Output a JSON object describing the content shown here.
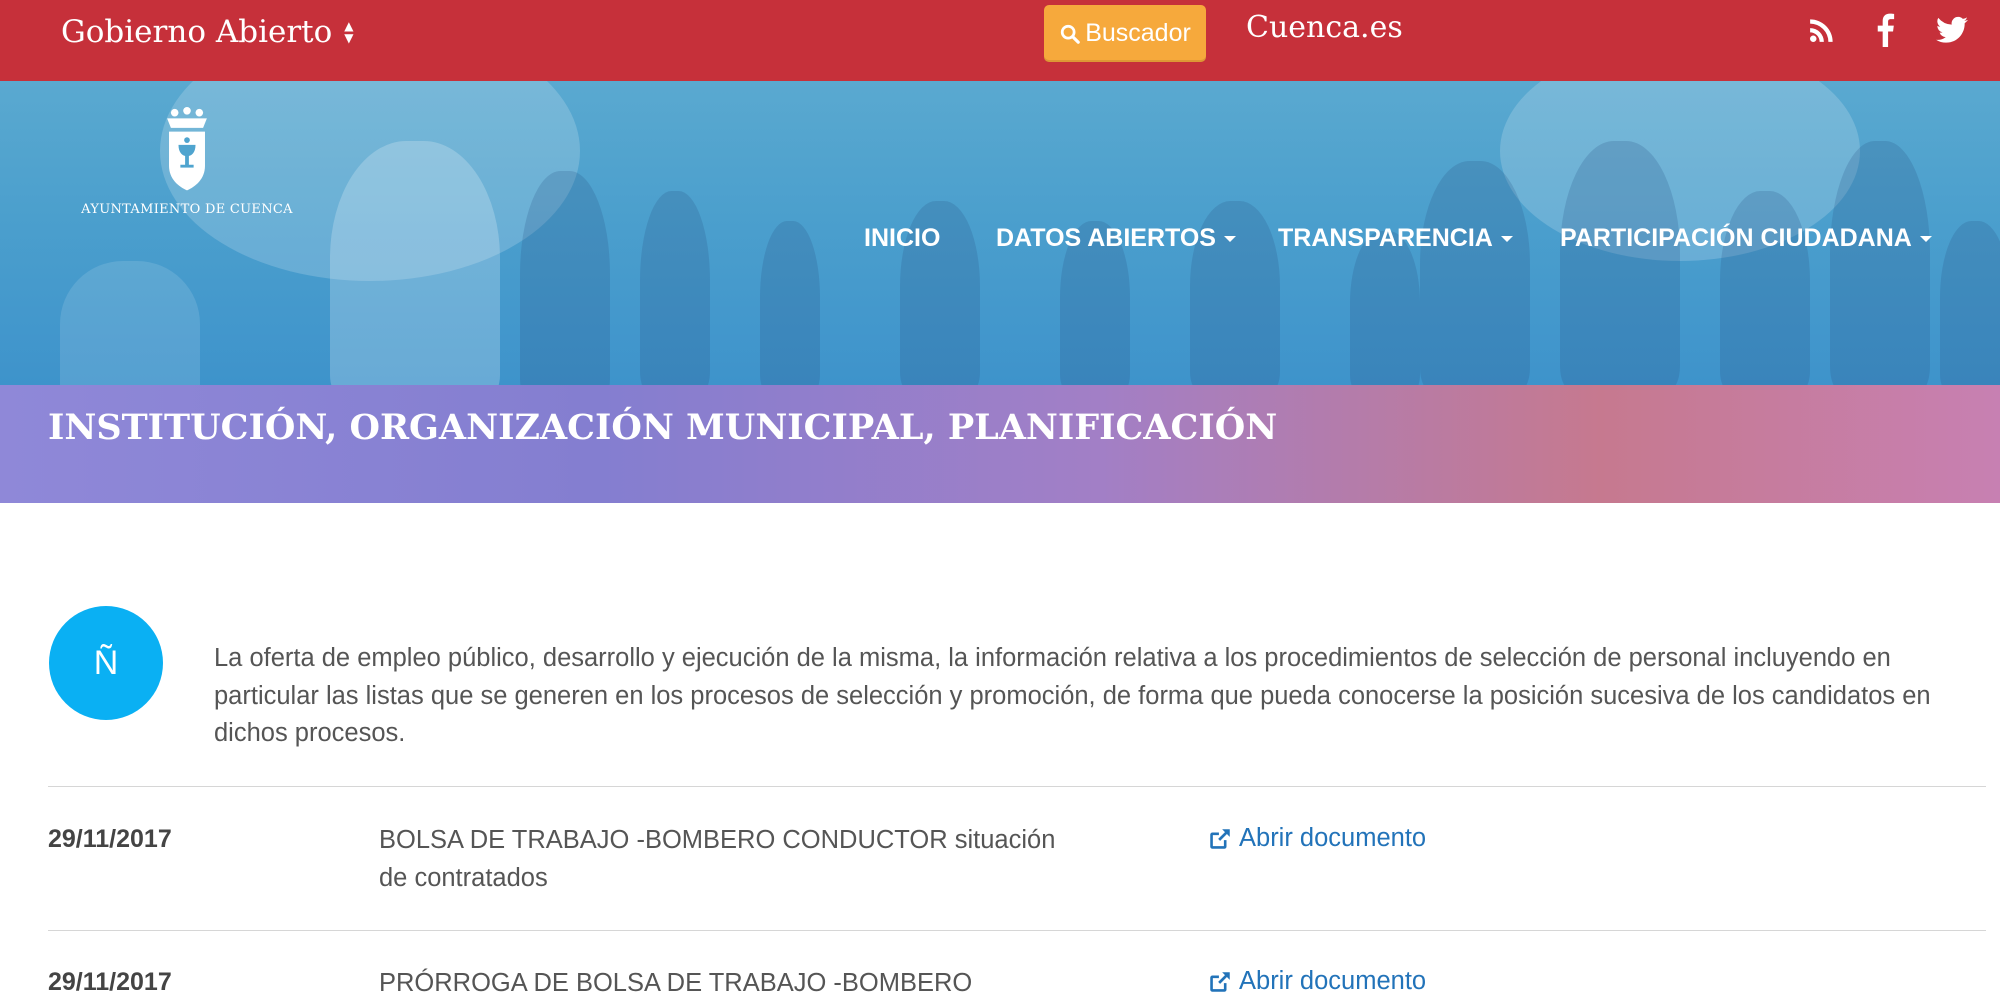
{
  "topbar": {
    "brand_label": "Gobierno Abierto",
    "search_label": "Buscador",
    "site_link": "Cuenca.es",
    "social_icons": [
      "rss-icon",
      "facebook-icon",
      "twitter-icon"
    ],
    "background_color": "#c6303a",
    "search_color": "#f6a93c"
  },
  "hero": {
    "logo_caption": "AYUNTAMIENTO DE CUENCA",
    "nav": [
      {
        "label": "INICIO",
        "has_dropdown": false
      },
      {
        "label": "DATOS ABIERTOS",
        "has_dropdown": true
      },
      {
        "label": "TRANSPARENCIA",
        "has_dropdown": true
      },
      {
        "label": "PARTICIPACIÓN CIUDADANA",
        "has_dropdown": true
      }
    ]
  },
  "section": {
    "title": "INSTITUCIÓN, ORGANIZACIÓN MUNICIPAL, PLANIFICACIÓN",
    "badge": "Ñ",
    "badge_color": "#0ab0f3",
    "description": "La oferta de empleo público, desarrollo y ejecución de la misma, la información relativa a los procedimientos de selección de personal incluyendo en particular las listas que se generen en los procesos de selección y promoción, de forma que pueda conocerse la posición sucesiva de los candidatos en dichos procesos."
  },
  "documents": [
    {
      "date": "29/11/2017",
      "title": "BOLSA DE TRABAJO -BOMBERO CONDUCTOR situación de contratados",
      "link": "Abrir documento"
    },
    {
      "date": "29/11/2017",
      "title": "PRÓRROGA DE BOLSA DE TRABAJO -BOMBERO",
      "link": "Abrir documento"
    }
  ],
  "link_color": "#2273b9"
}
